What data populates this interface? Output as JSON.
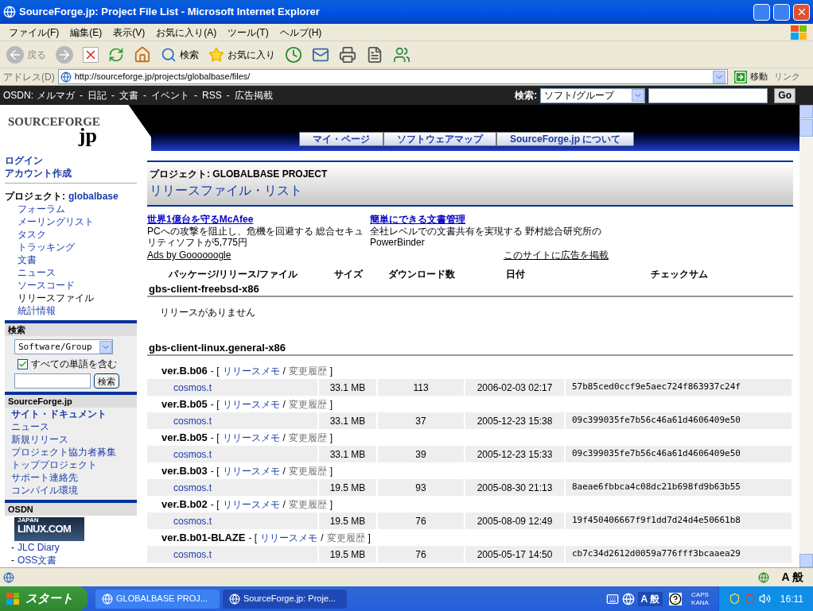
{
  "window": {
    "title": "SourceForge.jp: Project File List - Microsoft Internet Explorer"
  },
  "menu": [
    "ファイル(F)",
    "編集(E)",
    "表示(V)",
    "お気に入り(A)",
    "ツール(T)",
    "ヘルプ(H)"
  ],
  "toolbar": {
    "back": "戻る",
    "search": "検索",
    "favorites": "お気に入り"
  },
  "address": {
    "label": "アドレス(D)",
    "url": "http://sourceforge.jp/projects/globalbase/files/",
    "go": "移動",
    "links": "リンク"
  },
  "osdn_bar": {
    "label": "OSDN:",
    "separator": "-",
    "links": [
      "メルマガ",
      "日記",
      "文書",
      "イベント",
      "RSS",
      "広告掲載"
    ],
    "search_label": "検索:",
    "select": "ソフト/グループ",
    "go": "Go"
  },
  "logo": {
    "text": "SOURCEFORGE",
    "suffix": "jp"
  },
  "tabs": [
    {
      "label": "マイ・ページ"
    },
    {
      "label": "ソフトウェアマップ"
    },
    {
      "label": "SourceForge.jp について"
    }
  ],
  "sidebar": {
    "account": [
      "ログイン",
      "アカウント作成"
    ],
    "project_label": "プロジェクト:",
    "project_name": "globalbase",
    "project_items": [
      {
        "label": "フォーラム",
        "selected": false
      },
      {
        "label": "メーリングリスト",
        "selected": false
      },
      {
        "label": "タスク",
        "selected": false
      },
      {
        "label": "トラッキング",
        "selected": false
      },
      {
        "label": "文書",
        "selected": false
      },
      {
        "label": "ニュース",
        "selected": false
      },
      {
        "label": "ソースコード",
        "selected": false
      },
      {
        "label": "リリースファイル",
        "selected": true
      },
      {
        "label": "統計情報",
        "selected": false
      }
    ],
    "search": {
      "title": "検索",
      "select": "Software/Group",
      "checkbox": {
        "label": "すべての単語を含む",
        "checked": true
      },
      "button": "検索"
    },
    "site": {
      "title": "SourceForge.jp",
      "items": [
        {
          "label": "サイト・ドキュメント",
          "bold": true
        },
        {
          "label": "ニュース",
          "bold": false
        },
        {
          "label": "新規リリース",
          "bold": false
        },
        {
          "label": "プロジェクト協力者募集",
          "bold": false
        },
        {
          "label": "トッププロジェクト",
          "bold": false
        },
        {
          "label": "サポート連絡先",
          "bold": false
        },
        {
          "label": "コンパイル環境",
          "bold": false
        }
      ]
    },
    "osdn": {
      "title": "OSDN",
      "banner": {
        "top": "JAPAN",
        "main": "LINUX.COM"
      },
      "links": [
        {
          "bullet": "-",
          "label": "JLC Diary"
        },
        {
          "bullet": "-",
          "label": "OSS文書"
        }
      ]
    }
  },
  "content": {
    "project": "プロジェクト: GLOBALBASE PROJECT",
    "title": "リリースファイル・リスト",
    "ads": [
      {
        "title": "世界1億台を守るMcAfee",
        "text": "PCへの攻撃を阻止し、危機を回避する 総合セキュリティソフトが5,775円"
      },
      {
        "title": "簡単にできる文書管理",
        "text": "全社レベルでの文書共有を実現する 野村総合研究所のPowerBinder"
      }
    ],
    "ads_by": "Ads by Goooooogle",
    "advertise": "このサイトに広告を掲載",
    "table": {
      "columns": [
        "パッケージ/リリース/ファイル",
        "サイズ",
        "ダウンロード数",
        "日付",
        "チェックサム"
      ],
      "punct": [
        "- [",
        "/",
        "]"
      ],
      "packages": [
        {
          "name": "gbs-client-freebsd-x86",
          "empty": "リリースがありません"
        },
        {
          "name": "gbs-client-linux.general-x86",
          "releases": [
            {
              "version": "ver.B.b06",
              "notes": "リリースメモ",
              "changes": "変更履歴",
              "file": "cosmos.t",
              "size": "33.1 MB",
              "downloads": "113",
              "date": "2006-02-03 02:17",
              "checksum": "57b85ced0ccf9e5aec724f863937c24f"
            },
            {
              "version": "ver.B.b05",
              "notes": "リリースメモ",
              "changes": "変更履歴",
              "file": "cosmos.t",
              "size": "33.1 MB",
              "downloads": "37",
              "date": "2005-12-23 15:38",
              "checksum": "09c399035fe7b56c46a61d4606409e50"
            },
            {
              "version": "ver.B.b05",
              "notes": "リリースメモ",
              "changes": "変更履歴",
              "file": "cosmos.t",
              "size": "33.1 MB",
              "downloads": "39",
              "date": "2005-12-23 15:33",
              "checksum": "09c399035fe7b56c46a61d4606409e50"
            },
            {
              "version": "ver.B.b03",
              "notes": "リリースメモ",
              "changes": "変更履歴",
              "file": "cosmos.t",
              "size": "19.5 MB",
              "downloads": "93",
              "date": "2005-08-30 21:13",
              "checksum": "8aeae6fbbca4c08dc21b698fd9b63b55"
            },
            {
              "version": "ver.B.b02",
              "notes": "リリースメモ",
              "changes": "変更履歴",
              "file": "cosmos.t",
              "size": "19.5 MB",
              "downloads": "76",
              "date": "2005-08-09 12:49",
              "checksum": "19f450406667f9f1dd7d24d4e50661b8"
            },
            {
              "version": "ver.B.b01-BLAZE",
              "notes": "リリースメモ",
              "changes": "変更履歴",
              "file": "cosmos.t",
              "size": "19.5 MB",
              "downloads": "76",
              "date": "2005-05-17 14:50",
              "checksum": "cb7c34d2612d0059a776fff3bcaaea29"
            }
          ]
        }
      ]
    }
  },
  "status_bar": {
    "ime": "A 般"
  },
  "taskbar": {
    "start": "スタート",
    "tasks": [
      {
        "label": "GLOBALBASE PROJ...",
        "selected": false
      },
      {
        "label": "SourceForge.jp: Proje...",
        "selected": true
      }
    ],
    "ime": "A 般",
    "caps": "CAPS",
    "kana": "KANA",
    "clock": "16:11"
  }
}
